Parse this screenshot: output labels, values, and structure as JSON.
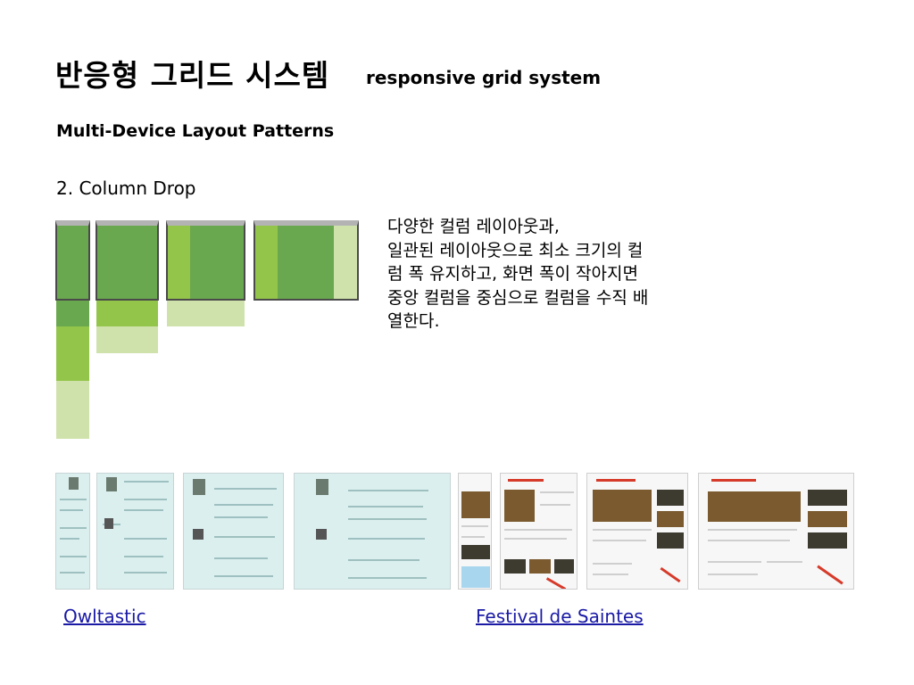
{
  "title": {
    "korean": "반응형 그리드 시스템",
    "english": "responsive grid system"
  },
  "subtitle": "Multi-Device Layout Patterns",
  "section": "2. Column Drop",
  "description": [
    "다양한 컬럼 레이아웃과,",
    "일관된 레이아웃으로 최소 크기의 컬",
    "럼 폭 유지하고, 화면 폭이 작아지면",
    "중앙 컬럼을 중심으로 컬럼을 수직 배",
    "열한다."
  ],
  "links": {
    "owltastic": "Owltastic",
    "festival": "Festival de Saintes"
  },
  "colors": {
    "green_dark": "#6aa84f",
    "green_mid": "#93c54b",
    "green_light": "#d0e2ac",
    "link": "#1a1aa6"
  }
}
